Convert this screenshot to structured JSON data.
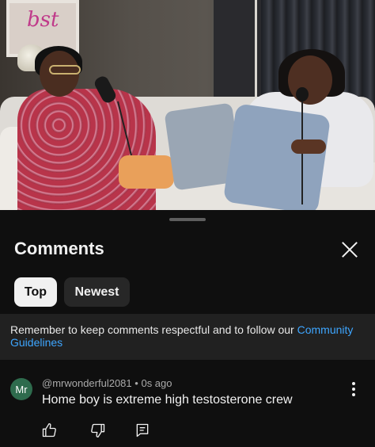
{
  "video": {
    "frame_logo_text": "bst",
    "description_icon": "video-thumbnail"
  },
  "comments_panel": {
    "title": "Comments",
    "close_icon": "close-icon",
    "sort_chips": [
      {
        "label": "Top",
        "selected": true
      },
      {
        "label": "Newest",
        "selected": false
      }
    ],
    "notice": {
      "text": "Remember to keep comments respectful and to follow our ",
      "link_text": "Community Guidelines"
    }
  },
  "comments": [
    {
      "avatar_initials": "Mr",
      "avatar_color": "#2e6b4d",
      "author": "@mrwonderful2081",
      "separator": "•",
      "time": "0s ago",
      "text": "Home boy is extreme high testosterone crew",
      "actions": [
        "thumbs-up-icon",
        "thumbs-down-icon",
        "reply-icon"
      ]
    }
  ],
  "colors": {
    "background": "#0f0f0f",
    "notice_bg": "#212121",
    "link": "#3ea6ff",
    "chip_selected_bg": "#f1f1f1",
    "chip_bg": "#272727"
  }
}
